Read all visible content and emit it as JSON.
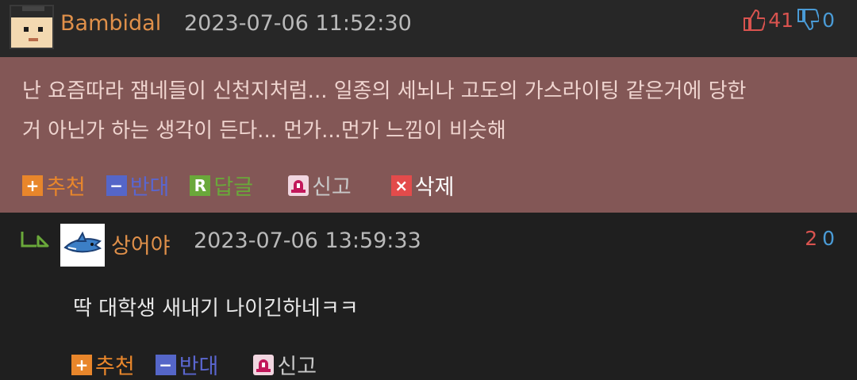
{
  "comment": {
    "username": "Bambidal",
    "timestamp": "2023-07-06 11:52:30",
    "upvotes": "41",
    "downvotes": "0",
    "body_line1": "난 요즘따라 잼네들이 신천지처럼... 일종의 세뇌나 고도의 가스라이팅 같은거에 당한",
    "body_line2": "거 아닌가 하는 생각이 든다... 먼가...먼가 느낌이 비슷해",
    "actions": {
      "recommend": "추천",
      "oppose": "반대",
      "reply": "답글",
      "report": "신고",
      "delete": "삭제"
    }
  },
  "reply": {
    "username": "상어야",
    "timestamp": "2023-07-06 13:59:33",
    "upvotes": "2",
    "downvotes": "0",
    "body": "딱 대학생 새내기 나이긴하네ㅋㅋ",
    "actions": {
      "recommend": "추천",
      "oppose": "반대",
      "report": "신고"
    }
  },
  "colors": {
    "highlight_bg": "#835756",
    "username": "#e0904a",
    "upvote": "#d9534f",
    "downvote": "#4a9bd6"
  },
  "icons": {
    "upvote": "thumbs-up-icon",
    "downvote": "thumbs-down-icon",
    "reply_arrow": "reply-arrow-icon"
  }
}
